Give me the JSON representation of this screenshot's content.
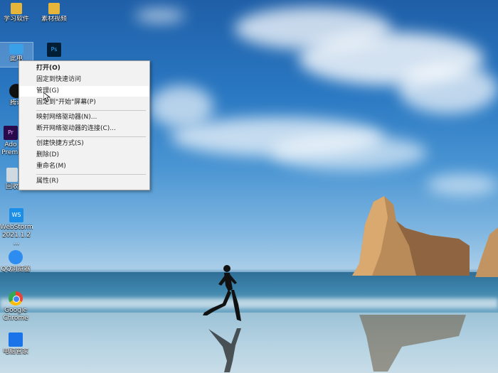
{
  "desktop_icons": [
    {
      "name": "study-software",
      "label": "学习软件",
      "icon": "folder-icon",
      "color": "#e8b53b"
    },
    {
      "name": "material-video",
      "label": "素材视频",
      "icon": "video-folder-icon",
      "color": "#e8b53b"
    },
    {
      "name": "this-pc",
      "label": "此电",
      "icon": "computer-icon",
      "color": "#3aa0e8"
    },
    {
      "name": "photoshop",
      "label": "",
      "icon": "photoshop-icon",
      "color": "#001e36"
    },
    {
      "name": "qq",
      "label": "腾讯",
      "icon": "qq-penguin-icon",
      "color": "#111111"
    },
    {
      "name": "premiere",
      "label": "Ado\nPremi",
      "icon": "premiere-icon",
      "color": "#2a0a4a"
    },
    {
      "name": "recycle-bin",
      "label": "回收",
      "icon": "recycle-bin-icon",
      "color": "#d0d8e0"
    },
    {
      "name": "webstorm",
      "label": "WebStorm\n2021.1.2 ...",
      "icon": "webstorm-icon",
      "color": "#1b8ee8"
    },
    {
      "name": "qq-browser",
      "label": "QQ浏览器",
      "icon": "qq-browser-icon",
      "color": "#2d8cf0"
    },
    {
      "name": "chrome",
      "label": "Google\nChrome",
      "icon": "chrome-icon",
      "color": "#4285f4"
    },
    {
      "name": "pc-manager",
      "label": "电脑管家",
      "icon": "shield-icon",
      "color": "#1a73e8"
    }
  ],
  "context_menu": {
    "items": [
      {
        "name": "menu-open",
        "label": "打开(O)",
        "bold": true
      },
      {
        "name": "menu-pin-quick-access",
        "label": "固定到快速访问"
      },
      {
        "name": "menu-manage",
        "label": "管理(G)",
        "hover": true
      },
      {
        "name": "menu-pin-start",
        "label": "固定到\"开始\"屏幕(P)"
      },
      {
        "name": "menu-map-drive",
        "label": "映射网络驱动器(N)..."
      },
      {
        "name": "menu-disconnect-drive",
        "label": "断开网络驱动器的连接(C)..."
      },
      {
        "name": "menu-create-shortcut",
        "label": "创建快捷方式(S)"
      },
      {
        "name": "menu-delete",
        "label": "删除(D)"
      },
      {
        "name": "menu-rename",
        "label": "重命名(M)"
      },
      {
        "name": "menu-properties",
        "label": "属性(R)"
      }
    ]
  }
}
